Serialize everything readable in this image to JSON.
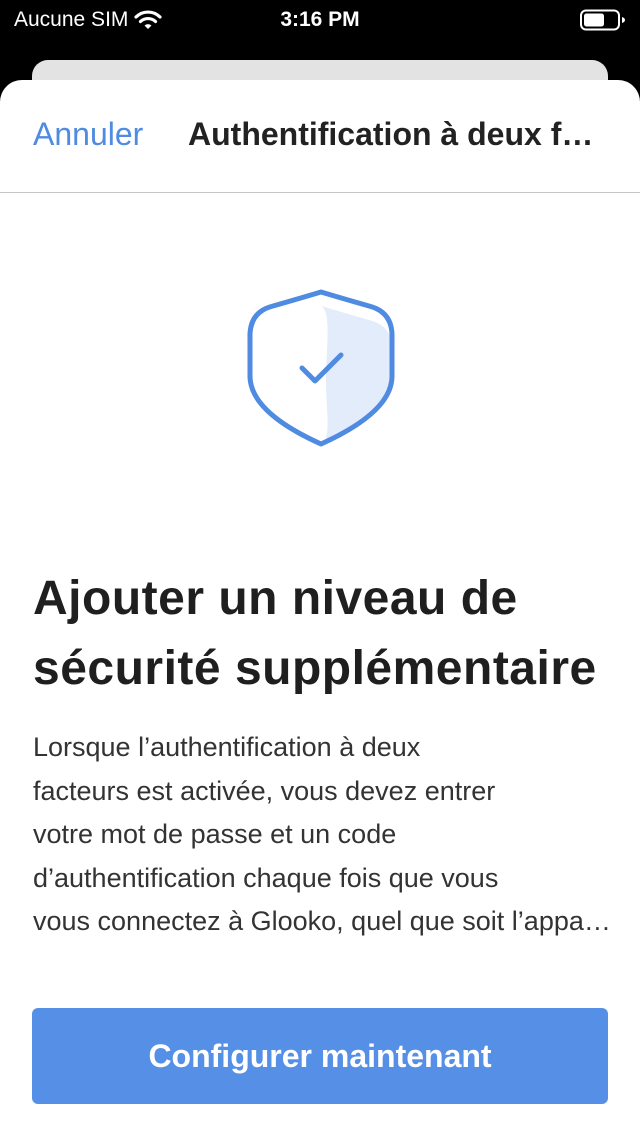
{
  "status_bar": {
    "carrier": "Aucune SIM",
    "time": "3:16 PM",
    "wifi_icon": "wifi-icon",
    "battery_icon": "battery-icon"
  },
  "nav": {
    "cancel_label": "Annuler",
    "title": "Authentification à deux facteurs"
  },
  "hero": {
    "icon": "shield-check-icon",
    "headline_lines": [
      "Ajouter un niveau de",
      "sécurité supplémentaire"
    ],
    "body_lines": [
      "Lorsque l’authentification à deux",
      "facteurs est activée, vous devez entrer",
      "votre mot de passe et un code",
      "d’authentification chaque fois que vous",
      "vous connectez à Glooko, quel que soit l’appareil."
    ]
  },
  "actions": {
    "primary_label": "Configurer maintenant"
  },
  "colors": {
    "accent": "#4f8be0",
    "button": "#5590e6",
    "shield_fill": "#e2ecfb"
  }
}
